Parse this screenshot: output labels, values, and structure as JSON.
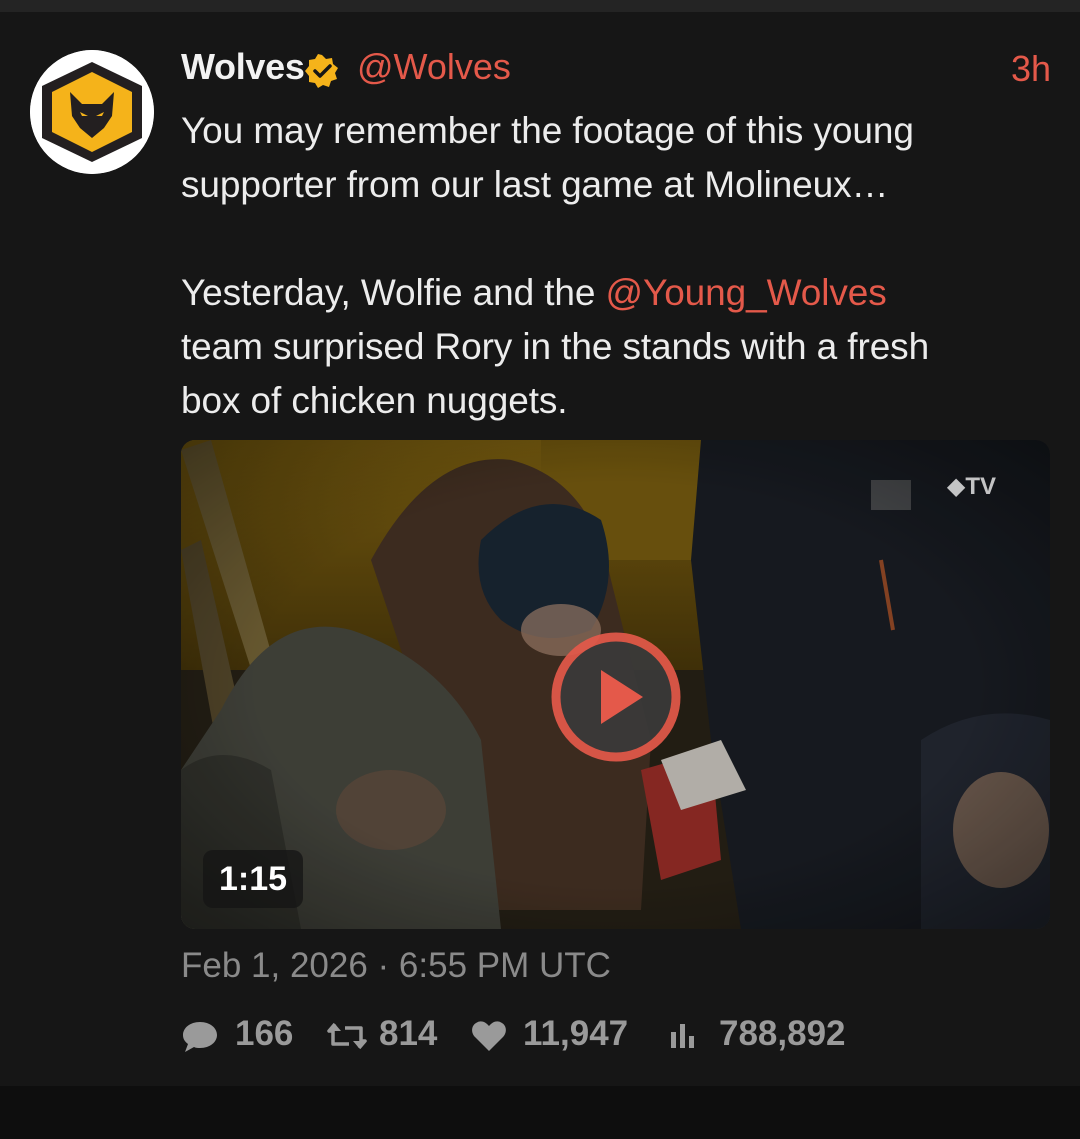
{
  "tweet": {
    "display_name": "Wolves",
    "verified_icon": "verified-badge-icon",
    "handle": "@Wolves",
    "time_ago": "3h",
    "text": {
      "line_1": "You may remember the footage of this young",
      "line_2": "supporter from our last game at Molineux…",
      "para_2_prefix": "Yesterday, Wolfie and the ",
      "mention": "@Young_Wolves",
      "line_4": "team surprised Rory in the stands with a fresh",
      "line_5": "box of chicken nuggets."
    },
    "date": "Feb 1, 2026 · 6:55 PM UTC"
  },
  "video": {
    "duration": "1:15",
    "watermark": "TV"
  },
  "stats": {
    "replies": "166",
    "retweets": "814",
    "likes": "11,947",
    "views": "788,892"
  },
  "colors": {
    "accent": "#e4594a",
    "brand_gold": "#f5b31a",
    "background": "#161616"
  }
}
